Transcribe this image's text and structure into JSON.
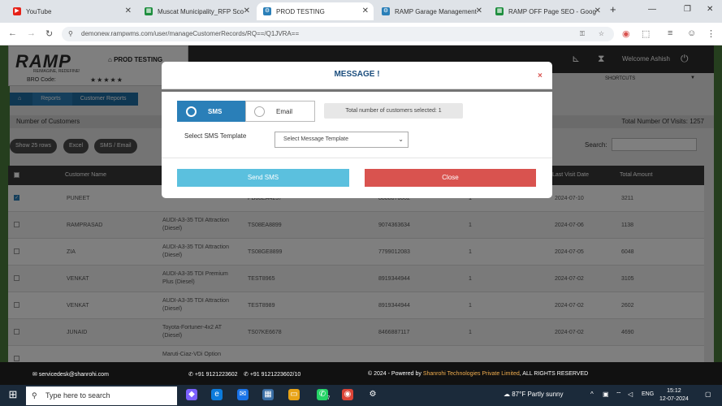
{
  "browser": {
    "tabs": [
      {
        "title": "YouTube",
        "icon": "youtube-icon",
        "color": "#e62117"
      },
      {
        "title": "Muscat Municipality_RFP Sco",
        "icon": "sheets-icon",
        "color": "#1e8e3e"
      },
      {
        "title": "PROD TESTING",
        "icon": "chrome-settings-icon",
        "color": "#2a7fb8"
      },
      {
        "title": "RAMP Garage Management",
        "icon": "chrome-settings-icon",
        "color": "#2a7fb8"
      },
      {
        "title": "RAMP OFF Page SEO - Goog",
        "icon": "sheets-icon",
        "color": "#1e8e3e"
      }
    ],
    "new_tab": "+",
    "url": "demonew.rampwms.com/user/manageCustomerRecords/RQ==/Q1JVRA=="
  },
  "app": {
    "logo": "RAMP",
    "tagline": "REIMAGINE, REDEFINE!",
    "env_label": "PROD TESTING",
    "bro_code_label": "BRO Code:",
    "stars": "★★★★★",
    "welcome": "Welcome  Ashish",
    "shortcuts": "SHORTCUTS",
    "breadcrumb": [
      "Reports",
      "Customer Reports"
    ],
    "number_of_customers": "Number of Customers",
    "total_visits": "Total Number Of Visits: 1257",
    "toolbar": [
      "Show 25 rows",
      "Excel",
      "SMS / Email"
    ],
    "search_label": "Search:",
    "table_headers": {
      "customer_name": "Customer Name",
      "last_visit": "Last Visit Date",
      "total_amount": "Total Amount"
    },
    "rows": [
      {
        "name": "PUNEET",
        "vehicle": "(Diesel)",
        "reg": "PB08EA4237",
        "phone": "8888876002",
        "visits": "1",
        "date": "2024-07-10",
        "amount": "3211",
        "checked": true
      },
      {
        "name": "RAMPRASAD",
        "vehicle": "AUDI-A3-35 TDI Attraction (Diesel)",
        "reg": "TS08EA8899",
        "phone": "9074363634",
        "visits": "1",
        "date": "2024-07-06",
        "amount": "1138",
        "checked": false
      },
      {
        "name": "ZIA",
        "vehicle": "AUDI-A3-35 TDI Attraction (Diesel)",
        "reg": "TS08GE8899",
        "phone": "7799012083",
        "visits": "1",
        "date": "2024-07-05",
        "amount": "6048",
        "checked": false
      },
      {
        "name": "VENKAT",
        "vehicle": "AUDI-A3-35 TDI Premium Plus (Diesel)",
        "reg": "TEST8965",
        "phone": "8919344944",
        "visits": "1",
        "date": "2024-07-02",
        "amount": "3105",
        "checked": false
      },
      {
        "name": "VENKAT",
        "vehicle": "AUDI-A3-35 TDI Attraction (Diesel)",
        "reg": "TEST8989",
        "phone": "8919344944",
        "visits": "1",
        "date": "2024-07-02",
        "amount": "2602",
        "checked": false
      },
      {
        "name": "JUNAID",
        "vehicle": "Toyota-Fortuner-4x2 AT (Diesel)",
        "reg": "TS07KE6678",
        "phone": "8466887117",
        "visits": "1",
        "date": "2024-07-02",
        "amount": "4690",
        "checked": false
      },
      {
        "name": "",
        "vehicle": "Maruti-Ciaz-VDi Option",
        "reg": "",
        "phone": "",
        "visits": "",
        "date": "",
        "amount": "",
        "checked": false
      }
    ]
  },
  "modal": {
    "title": "MESSAGE !",
    "close_x": "×",
    "option_sms": "SMS",
    "option_email": "Email",
    "selected_option": "SMS",
    "total_selected": "Total number of customers selected: 1",
    "template_label": "Select SMS Template",
    "template_placeholder": "Select Message Template",
    "send_label": "Send SMS",
    "close_label": "Close"
  },
  "footer": {
    "email": "servicedesk@shanrohi.com",
    "phones": "+91 9121223602",
    "phones2": "+91 9121223602/10",
    "copyright_prefix": "© 2024 - Powered by ",
    "company": "Shanrohi Technologies Private Limited",
    "copyright_suffix": ", ALL RIGHTS RESERVED"
  },
  "taskbar": {
    "search_placeholder": "Type here to search",
    "weather": "87°F  Partly sunny",
    "lang": "ENG",
    "time": "15:12",
    "date": "12-07-2024",
    "notif_count": "7"
  },
  "colors": {
    "primary": "#2a7fb8",
    "success_info": "#5bc0de",
    "danger": "#d9534f",
    "header": "#2d2d2d"
  }
}
